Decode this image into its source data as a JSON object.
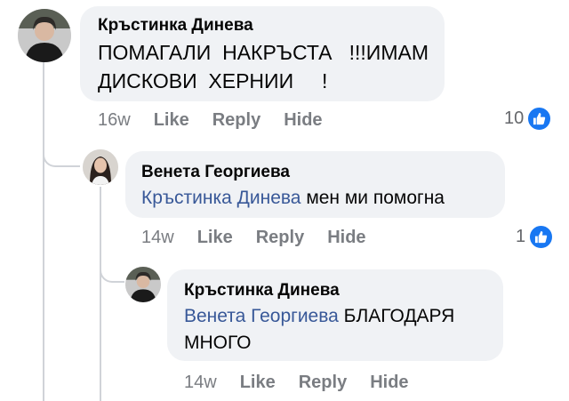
{
  "colors": {
    "mention": "#385898",
    "like_badge": "#1877f2",
    "bubble": "#f0f2f5"
  },
  "comments": [
    {
      "author": "Кръстинка Динева",
      "line1": "ПОМАГАЛИ  НАКРЪСТА   !!!ИМАМ",
      "line2": "ДИСКОВИ  ХЕРНИИ     !",
      "time": "16w",
      "like": "Like",
      "reply": "Reply",
      "hide": "Hide",
      "reaction_count": "10",
      "reaction_icon": "thumbs-up-icon"
    },
    {
      "author": "Венета Георгиева",
      "mention": "Кръстинка Динева",
      "text": " мен ми помогна",
      "time": "14w",
      "like": "Like",
      "reply": "Reply",
      "hide": "Hide",
      "reaction_count": "1",
      "reaction_icon": "thumbs-up-icon"
    },
    {
      "author": "Кръстинка Динева",
      "mention": "Венета Георгиева",
      "text": " БЛАГОДАРЯ",
      "line2": "МНОГО",
      "time": "14w",
      "like": "Like",
      "reply": "Reply",
      "hide": "Hide"
    }
  ]
}
